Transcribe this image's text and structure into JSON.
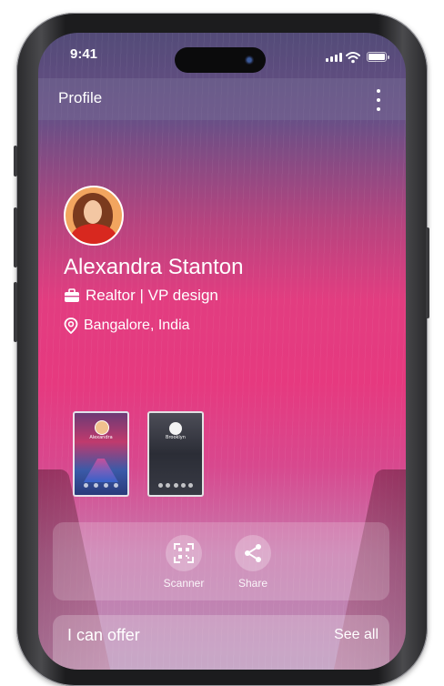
{
  "status_bar": {
    "time": "9:41"
  },
  "header": {
    "title": "Profile",
    "menu_icon": "more-vertical-icon"
  },
  "profile": {
    "name": "Alexandra Stanton",
    "role": "Realtor | VP design",
    "location": "Bangalore, India",
    "role_icon": "briefcase-icon",
    "location_icon": "location-pin-icon"
  },
  "cards": [
    {
      "name": "Alexandra"
    },
    {
      "name": "Brooklyn"
    }
  ],
  "actions": [
    {
      "label": "Scanner",
      "icon": "qr-scanner-icon"
    },
    {
      "label": "Share",
      "icon": "share-icon"
    }
  ],
  "offer_section": {
    "title": "I can offer",
    "link": "See all"
  },
  "colors": {
    "accent": "#e23d80",
    "header_overlay": "#786e96"
  }
}
